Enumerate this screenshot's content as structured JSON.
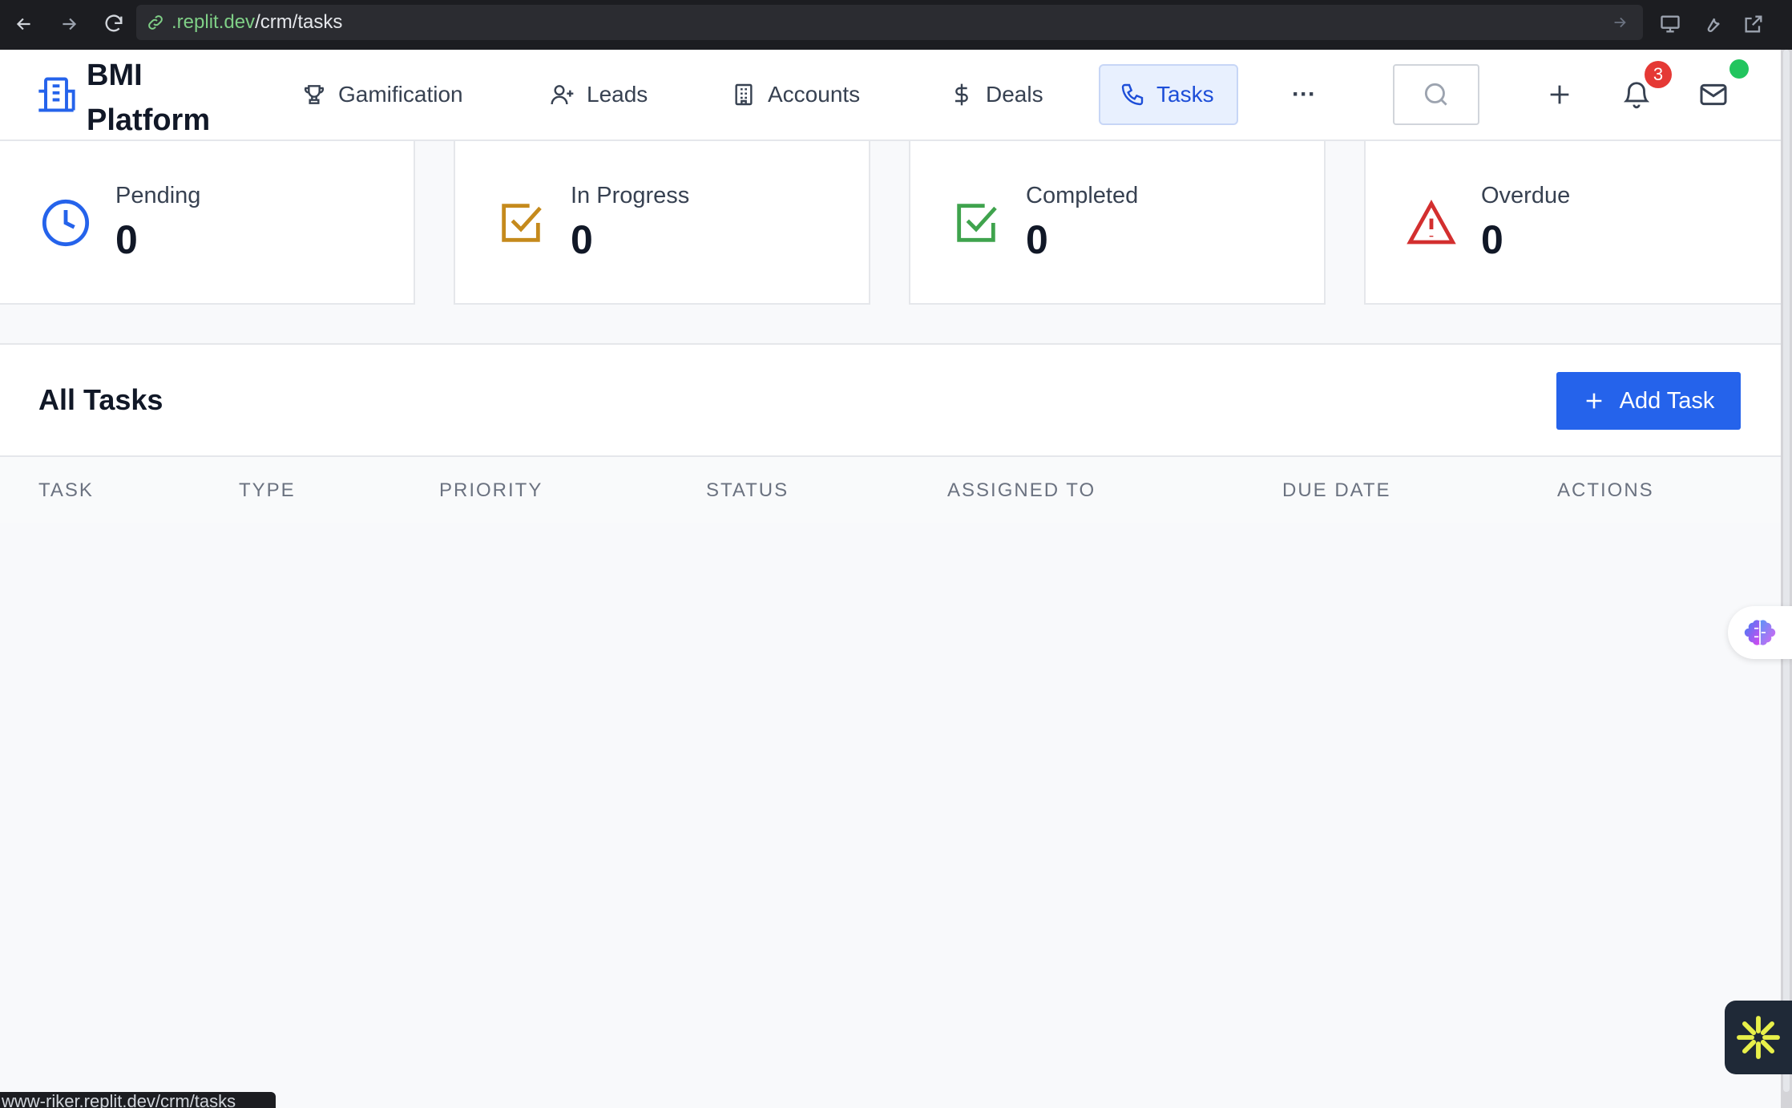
{
  "browser": {
    "url_domain": ".replit.dev",
    "url_path": "/crm/tasks",
    "status_url": "www-riker.replit.dev/crm/tasks"
  },
  "header": {
    "brand_line1": "BMI",
    "brand_line2": "Platform",
    "nav": [
      {
        "label": "Gamification",
        "icon": "trophy-icon"
      },
      {
        "label": "Leads",
        "icon": "user-plus-icon"
      },
      {
        "label": "Accounts",
        "icon": "building-icon"
      },
      {
        "label": "Deals",
        "icon": "dollar-icon"
      },
      {
        "label": "Tasks",
        "icon": "phone-icon",
        "active": true
      }
    ],
    "more_label": "···",
    "notification_count": "3"
  },
  "stats": [
    {
      "label": "Pending",
      "value": "0",
      "icon": "clock-icon",
      "color": "#2563eb"
    },
    {
      "label": "In Progress",
      "value": "0",
      "icon": "checkbox-icon",
      "color": "#c58a1c"
    },
    {
      "label": "Completed",
      "value": "0",
      "icon": "checkbox-icon",
      "color": "#3fa34d"
    },
    {
      "label": "Overdue",
      "value": "0",
      "icon": "warning-icon",
      "color": "#d32f2f"
    }
  ],
  "tasks": {
    "title": "All Tasks",
    "add_label": "Add Task",
    "columns": [
      "TASK",
      "TYPE",
      "PRIORITY",
      "STATUS",
      "ASSIGNED TO",
      "DUE DATE",
      "ACTIONS"
    ]
  },
  "colors": {
    "accent": "#2563eb",
    "active_nav_bg": "#e8f0fe"
  }
}
